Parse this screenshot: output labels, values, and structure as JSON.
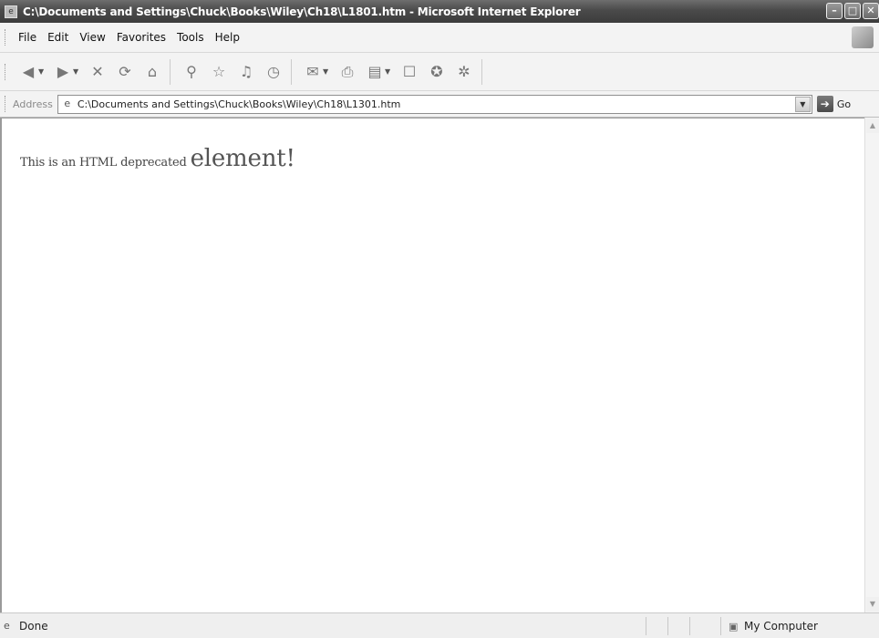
{
  "window": {
    "title": "C:\\Documents and Settings\\Chuck\\Books\\Wiley\\Ch18\\L1801.htm - Microsoft Internet Explorer",
    "buttons": {
      "minimize": "–",
      "maximize": "□",
      "close": "✕"
    }
  },
  "menu": {
    "items": [
      "File",
      "Edit",
      "View",
      "Favorites",
      "Tools",
      "Help"
    ]
  },
  "toolbar": {
    "icons": [
      "back-icon",
      "forward-icon",
      "stop-icon",
      "refresh-icon",
      "home-icon",
      "search-icon",
      "favorites-icon",
      "media-icon",
      "history-icon",
      "mail-icon",
      "print-icon",
      "edit-icon",
      "discuss-icon",
      "messenger-icon",
      "research-icon"
    ]
  },
  "address": {
    "label": "Address",
    "value": "C:\\Documents and Settings\\Chuck\\Books\\Wiley\\Ch18\\L1301.htm",
    "go_label": "Go"
  },
  "page": {
    "text_small": "This is an HTML deprecated ",
    "text_big": "element!"
  },
  "status": {
    "text": "Done",
    "zone": "My Computer"
  }
}
